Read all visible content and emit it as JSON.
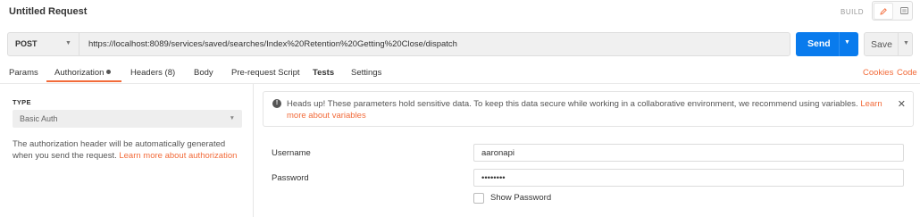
{
  "header": {
    "title": "Untitled Request",
    "build_label": "BUILD",
    "edit_icon": "pencil-icon",
    "comment_icon": "comment-icon"
  },
  "request": {
    "method": "POST",
    "url": "https://localhost:8089/services/saved/searches/Index%20Retention%20Getting%20Close/dispatch",
    "send_label": "Send",
    "save_label": "Save"
  },
  "tabs": [
    {
      "label": "Params"
    },
    {
      "label": "Authorization"
    },
    {
      "label": "Headers (8)"
    },
    {
      "label": "Body"
    },
    {
      "label": "Pre-request Script"
    },
    {
      "label": "Tests"
    },
    {
      "label": "Settings"
    }
  ],
  "right_links": {
    "cookies": "Cookies",
    "code": "Code"
  },
  "auth": {
    "type_heading": "TYPE",
    "type_value": "Basic Auth",
    "description": "The authorization header will be automatically generated when you send the request.",
    "learn_more": "Learn more about authorization"
  },
  "alert": {
    "text": "Heads up! These parameters hold sensitive data. To keep this data secure while working in a collaborative environment, we recommend using variables.",
    "link": "Learn more about variables"
  },
  "fields": {
    "username_label": "Username",
    "username_value": "aaronapi",
    "password_label": "Password",
    "password_value": "••••••••",
    "show_password_label": "Show Password"
  },
  "colors": {
    "accent": "#f26b3a",
    "send_blue": "#097bed"
  }
}
